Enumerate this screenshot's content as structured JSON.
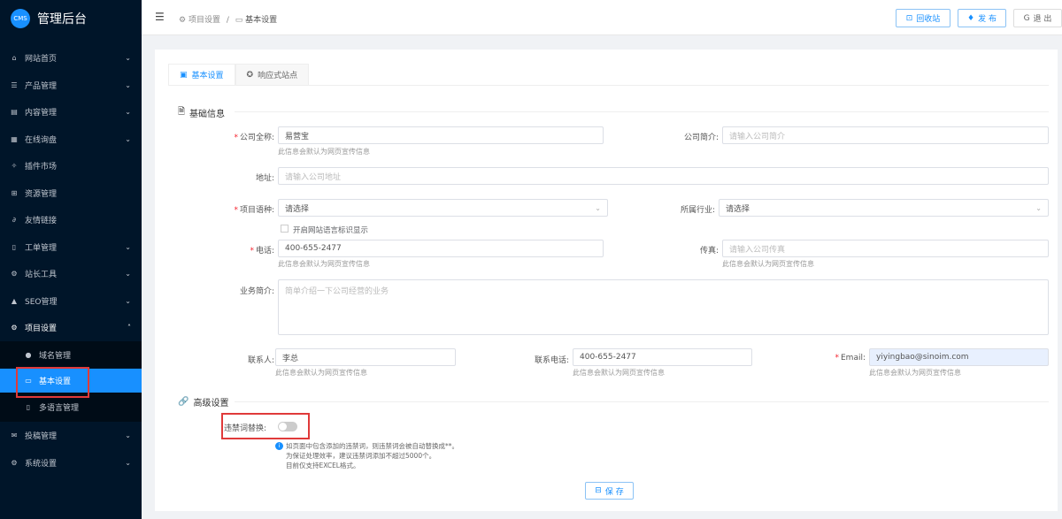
{
  "app": {
    "logo": "CMS",
    "title": "管理后台"
  },
  "sidebar": {
    "items": [
      {
        "label": "网站首页",
        "icon": "home-icon"
      },
      {
        "label": "产品管理",
        "icon": "product-icon"
      },
      {
        "label": "内容管理",
        "icon": "content-icon"
      },
      {
        "label": "在线询盘",
        "icon": "table-icon"
      },
      {
        "label": "插件市场",
        "icon": "plugin-icon"
      },
      {
        "label": "资源管理",
        "icon": "grid-icon"
      },
      {
        "label": "友情链接",
        "icon": "link-icon"
      },
      {
        "label": "工单管理",
        "icon": "ticket-icon"
      },
      {
        "label": "站长工具",
        "icon": "tools-icon"
      },
      {
        "label": "SEO管理",
        "icon": "warning-icon"
      },
      {
        "label": "项目设置",
        "icon": "gear-icon"
      }
    ],
    "sub_items": [
      {
        "label": "域名管理"
      },
      {
        "label": "基本设置"
      },
      {
        "label": "多语言管理"
      }
    ],
    "items_after": [
      {
        "label": "投稿管理"
      },
      {
        "label": "系统设置"
      }
    ]
  },
  "header": {
    "breadcrumb": [
      "项目设置",
      "基本设置"
    ],
    "separator": "/",
    "buttons": {
      "recycle": "回收站",
      "publish": "发 布",
      "logout": "退 出"
    }
  },
  "tabs": [
    "基本设置",
    "响应式站点"
  ],
  "sections": {
    "basic": "基础信息",
    "advanced": "高级设置"
  },
  "form": {
    "company_name": {
      "label": "公司全称:",
      "value": "易营宝",
      "hint": "此信息会默认为网页宣传信息"
    },
    "company_short": {
      "label": "公司简介:",
      "placeholder": "请输入公司简介"
    },
    "address": {
      "label": "地址:",
      "placeholder": "请输入公司地址"
    },
    "language": {
      "label": "项目语种:",
      "value": "请选择"
    },
    "industry": {
      "label": "所属行业:",
      "value": "请选择"
    },
    "lang_flag": {
      "label": "开启网站语言标识显示"
    },
    "phone": {
      "label": "电话:",
      "value": "400-655-2477",
      "hint": "此信息会默认为网页宣传信息"
    },
    "fax": {
      "label": "传真:",
      "placeholder": "请输入公司传真",
      "hint": "此信息会默认为网页宣传信息"
    },
    "business": {
      "label": "业务简介:",
      "placeholder": "简单介绍一下公司经营的业务"
    },
    "contact": {
      "label": "联系人:",
      "value": "李总",
      "hint": "此信息会默认为网页宣传信息"
    },
    "contact_phone": {
      "label": "联系电话:",
      "value": "400-655-2477",
      "hint": "此信息会默认为网页宣传信息"
    },
    "email": {
      "label": "Email:",
      "value": "yiyingbao@sinoim.com",
      "hint": "此信息会默认为网页宣传信息"
    },
    "forbidden": {
      "label": "违禁词替换:",
      "enabled": false,
      "info": [
        "如页面中包含添加的违禁词，则违禁词会被自动替换成**。",
        "为保证处理效率，建议违禁词添加不超过5000个。",
        "目前仅支持EXCEL格式。"
      ]
    }
  },
  "save": "保 存"
}
